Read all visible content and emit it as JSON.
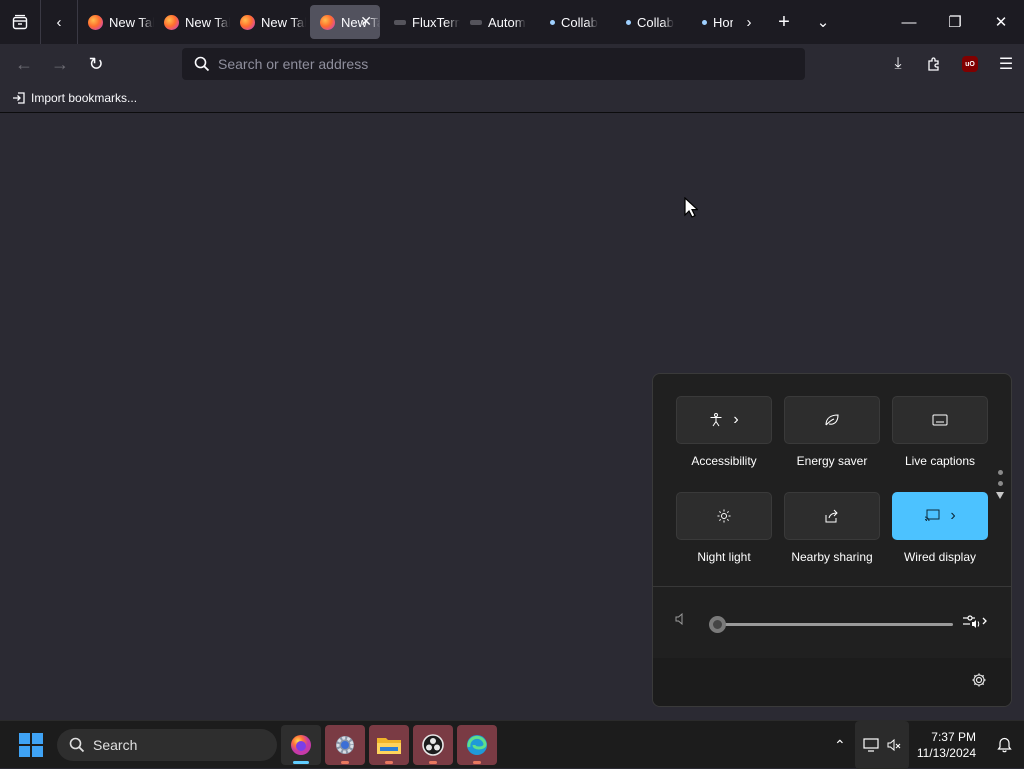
{
  "tabbar": {
    "tabs": [
      {
        "label": "New Tab",
        "icon": "firefox-icon",
        "active": false
      },
      {
        "label": "New Tab",
        "icon": "firefox-icon",
        "active": false
      },
      {
        "label": "New Tab",
        "icon": "firefox-icon",
        "active": false
      },
      {
        "label": "New Tab",
        "icon": "firefox-icon",
        "active": true
      },
      {
        "label": "FluxTerm",
        "icon": "page-icon",
        "active": false
      },
      {
        "label": "Autom",
        "icon": "page-icon",
        "active": false
      },
      {
        "label": "Collab",
        "icon": "dot-icon",
        "active": false
      },
      {
        "label": "Collab",
        "icon": "dot-icon",
        "active": false
      },
      {
        "label": "Home",
        "icon": "dot-icon",
        "active": false
      }
    ],
    "close_glyph": "✕",
    "new_tab_glyph": "+",
    "list_all_glyph": "⌄"
  },
  "window_controls": {
    "minimize": "—",
    "maximize": "❐",
    "close": "✕"
  },
  "navbar": {
    "url_placeholder": "Search or enter address",
    "url_value": ""
  },
  "bookmarks": {
    "import_label": "Import bookmarks..."
  },
  "quick_settings": {
    "tiles": [
      {
        "label": "Accessibility",
        "icon": "accessibility-icon",
        "has_chevron": true,
        "on": false
      },
      {
        "label": "Energy saver",
        "icon": "leaf-icon",
        "has_chevron": false,
        "on": false
      },
      {
        "label": "Live captions",
        "icon": "captions-icon",
        "has_chevron": false,
        "on": false
      },
      {
        "label": "Night light",
        "icon": "sun-icon",
        "has_chevron": false,
        "on": false
      },
      {
        "label": "Nearby sharing",
        "icon": "share-icon",
        "has_chevron": false,
        "on": false
      },
      {
        "label": "Wired display",
        "icon": "cast-icon",
        "has_chevron": true,
        "on": true
      }
    ],
    "volume": {
      "level": 0,
      "muted": true
    },
    "accent_color": "#4cc2ff"
  },
  "taskbar": {
    "search_label": "Search",
    "apps": [
      {
        "name": "firefox",
        "active": true
      },
      {
        "name": "settings",
        "active": false
      },
      {
        "name": "file-explorer",
        "active": false
      },
      {
        "name": "obs",
        "active": false
      },
      {
        "name": "edge",
        "active": false
      }
    ],
    "time": "7:37 PM",
    "date": "11/13/2024"
  }
}
